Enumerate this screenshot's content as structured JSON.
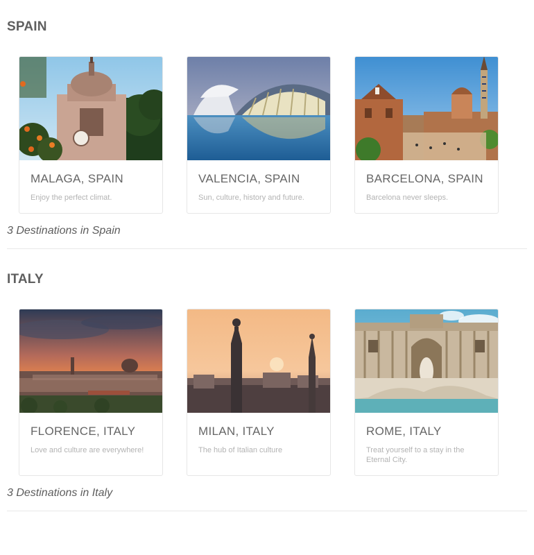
{
  "sections": [
    {
      "title": "SPAIN",
      "summary": "3 Destinations in Spain",
      "cards": [
        {
          "title": "MALAGA, SPAIN",
          "description": "Enjoy the perfect climat.",
          "image": "malaga-cathedral-photo"
        },
        {
          "title": "VALENCIA, SPAIN",
          "description": "Sun, culture, history and future.",
          "image": "valencia-arts-and-sciences-photo"
        },
        {
          "title": "BARCELONA, SPAIN",
          "description": "Barcelona never sleeps.",
          "image": "barcelona-park-guell-photo"
        }
      ]
    },
    {
      "title": "ITALY",
      "summary": "3 Destinations in Italy",
      "cards": [
        {
          "title": "FLORENCE, ITALY",
          "description": "Love and culture are everywhere!",
          "image": "florence-skyline-photo"
        },
        {
          "title": "MILAN, ITALY",
          "description": "The hub of Italian culture",
          "image": "milan-duomo-spires-photo"
        },
        {
          "title": "ROME, ITALY",
          "description": "Treat yourself to a stay in the Eternal City.",
          "image": "rome-trevi-fountain-photo"
        }
      ]
    }
  ],
  "colors": {
    "heading": "#5f5f5f",
    "card_title": "#666666",
    "card_desc": "#b3b3b3",
    "card_border": "#e6e6e6",
    "divider": "#e8e8e8"
  }
}
